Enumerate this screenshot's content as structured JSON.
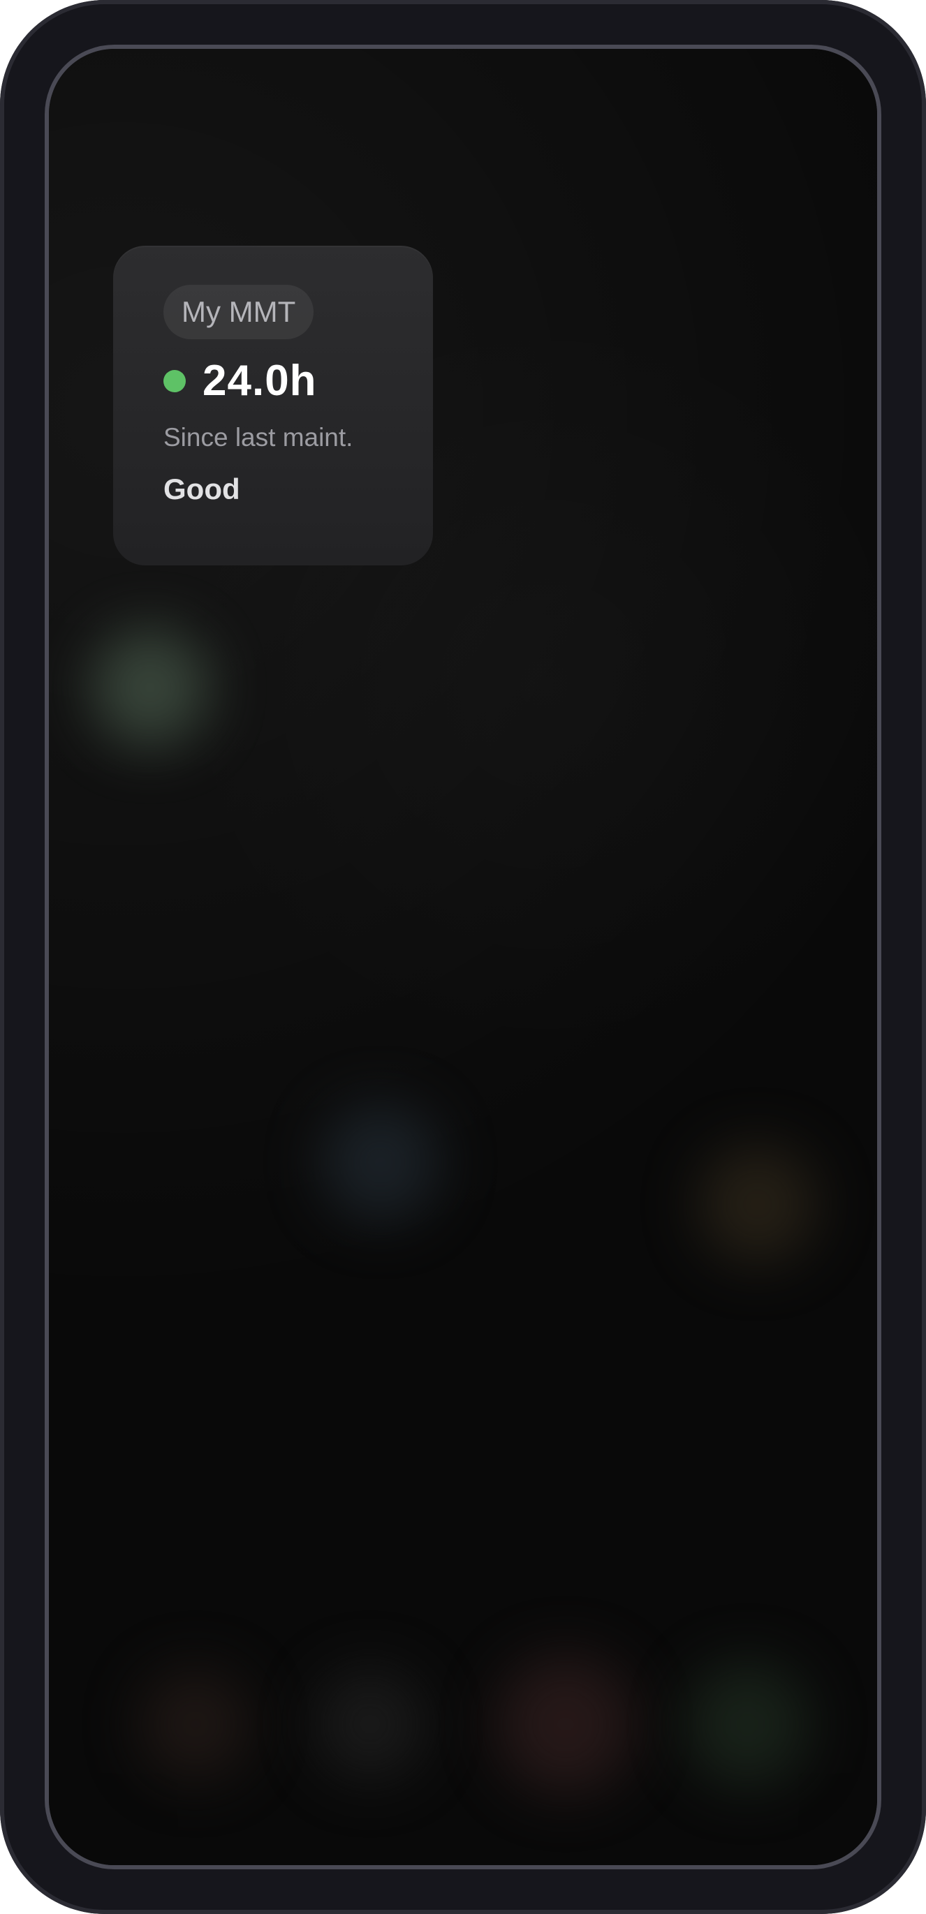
{
  "device": {
    "frame_color": "#16161c",
    "screen_color": "#0a0a0a"
  },
  "widget": {
    "app_name": "My MMT",
    "status_indicator": "green-dot",
    "status_color": "#5ec266",
    "hours_value": "24.0h",
    "subtitle": "Since last maint.",
    "condition": "Good"
  },
  "background": {
    "style": "blurred home-screen app icons",
    "blob_colors": [
      "#3a4a3a",
      "#222a30",
      "#2f281e",
      "#2a1c1a",
      "#1e2a1e",
      "#222222"
    ]
  }
}
